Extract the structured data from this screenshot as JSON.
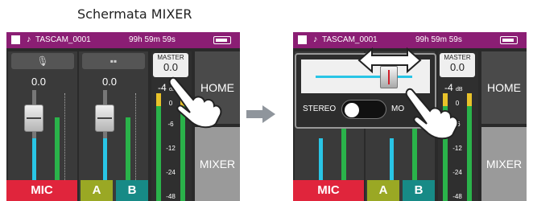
{
  "caption": "Schermata MIXER",
  "screens": {
    "topbar": {
      "project": "TASCAM_0001",
      "remaining_time": "99h 59m 59s"
    },
    "channels": [
      {
        "level": "0.0",
        "header_icon": "microphone-icon"
      },
      {
        "level": "0.0",
        "header_icon": "stereo-pair-icon"
      }
    ],
    "master": {
      "label": "MASTER",
      "value": "0.0",
      "db": "-4",
      "db_unit": "dB",
      "scale": [
        "0",
        "-6",
        "-12",
        "-24",
        "-48"
      ]
    },
    "bottom_buttons": {
      "mic": "MIC",
      "a": "A",
      "b": "B"
    },
    "nav": {
      "home": "HOME",
      "mixer": "MIXER"
    },
    "overlay": {
      "stereo": "STEREO",
      "mono": "MO"
    }
  },
  "colors": {
    "topbar": "#8b1e74",
    "mic": "#e0253c",
    "a": "#9aa824",
    "b": "#178a86",
    "meter": "#2ab34a",
    "fader_line": "#29c5e6"
  },
  "icons": [
    "hand-pointer-icon",
    "arrow-right-icon",
    "double-arrow-icon",
    "battery-icon",
    "music-note-icon"
  ]
}
